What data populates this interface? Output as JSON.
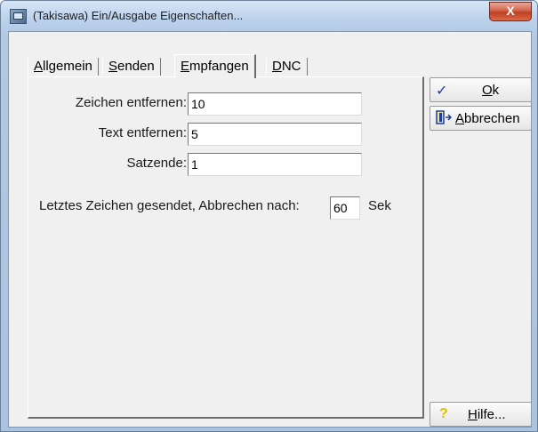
{
  "window": {
    "title": "(Takisawa) Ein/Ausgabe Eigenschaften...",
    "close_label": "X"
  },
  "tabs": [
    {
      "label_first": "A",
      "label_rest": "llgemein",
      "active": false
    },
    {
      "label_first": "S",
      "label_rest": "enden",
      "active": false
    },
    {
      "label_first": "E",
      "label_rest": "mpfangen",
      "active": true
    },
    {
      "label_first": "D",
      "label_rest": "NC",
      "active": false
    }
  ],
  "form": {
    "zeichen_label": "Zeichen entfernen:",
    "zeichen_value": "10",
    "text_label": "Text entfernen:",
    "text_value": "5",
    "satzende_label": "Satzende:",
    "satzende_value": "1",
    "timeout_label": "Letztes Zeichen gesendet, Abbrechen nach:",
    "timeout_value": "60",
    "timeout_unit": "Sek"
  },
  "buttons": {
    "ok_first": "O",
    "ok_rest": "k",
    "cancel_first": "A",
    "cancel_rest": "bbrechen",
    "help_first": "H",
    "help_rest": "ilfe..."
  },
  "colors": {
    "ok_check": "#1a3fa0",
    "help_icon": "#e0c000",
    "cancel_icon": "#1a3fa0"
  }
}
